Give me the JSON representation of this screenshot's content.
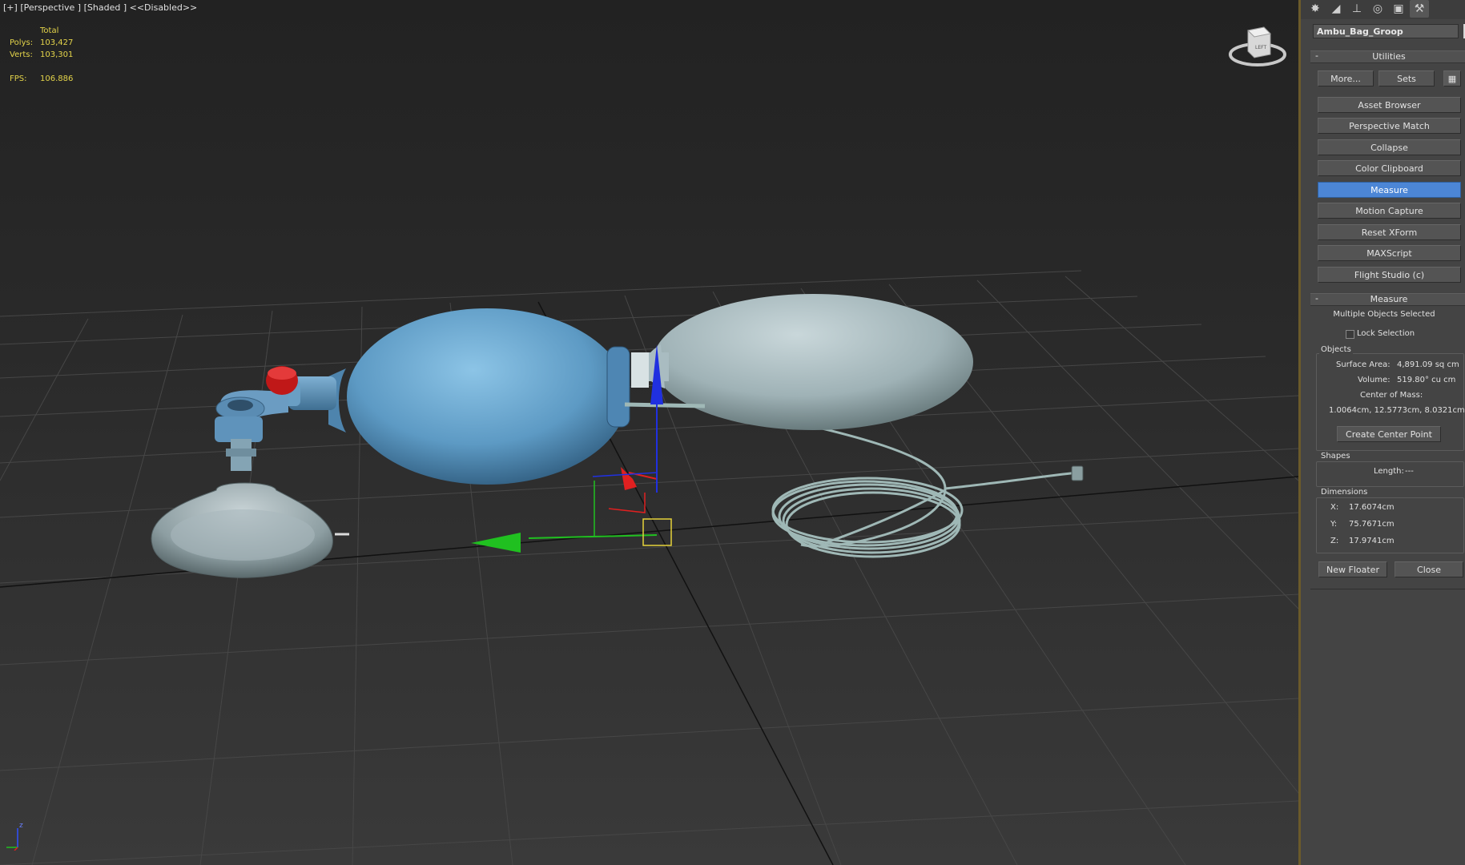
{
  "viewport": {
    "label_plus": "[+]",
    "label_view": "[Perspective ]",
    "label_shading": "[Shaded ]",
    "label_disabled": "<<Disabled>>",
    "stats": {
      "total_header": "Total",
      "polys_label": "Polys:",
      "polys_value": "103,427",
      "verts_label": "Verts:",
      "verts_value": "103,301",
      "fps_label": "FPS:",
      "fps_value": "106.886"
    },
    "viewcube_face": "LEFT",
    "tripod_z": "z",
    "colors": {
      "bag_blue": "#5d9ac4",
      "reservoir_grey": "#a9bcc1",
      "tube": "#9fb8b6",
      "gizmo_x": "#e02020",
      "gizmo_y": "#20c020",
      "gizmo_z": "#2030e0",
      "selection_box": "#e6d23a"
    }
  },
  "panel": {
    "tabs": [
      "create-icon",
      "modify-icon",
      "hierarchy-icon",
      "motion-icon",
      "display-icon",
      "utilities-icon"
    ],
    "object_name": "Ambu_Bag_Groop",
    "utilities": {
      "header": "Utilities",
      "more_button": "More...",
      "sets_button": "Sets",
      "items": [
        "Asset Browser",
        "Perspective Match",
        "Collapse",
        "Color Clipboard",
        "Measure",
        "Motion Capture",
        "Reset XForm",
        "MAXScript",
        "Flight Studio (c)"
      ],
      "selected_item": "Measure"
    },
    "measure": {
      "header": "Measure",
      "status": "Multiple Objects Selected",
      "lock_selection": "Lock Selection",
      "objects_group": "Objects",
      "surface_area_label": "Surface Area:",
      "surface_area_value": "4,891.09 sq cm",
      "volume_label": "Volume:",
      "volume_value": "519.80° cu cm",
      "center_label": "Center of Mass:",
      "center_value": "1.0064cm, 12.5773cm, 8.0321cm",
      "create_center_button": "Create Center Point",
      "shapes_group": "Shapes",
      "length_label": "Length:",
      "length_value": "---",
      "dimensions_group": "Dimensions",
      "x_label": "X:",
      "x_value": "17.6074cm",
      "y_label": "Y:",
      "y_value": "75.7671cm",
      "z_label": "Z:",
      "z_value": "17.9741cm",
      "new_floater_button": "New Floater",
      "close_button": "Close"
    }
  }
}
